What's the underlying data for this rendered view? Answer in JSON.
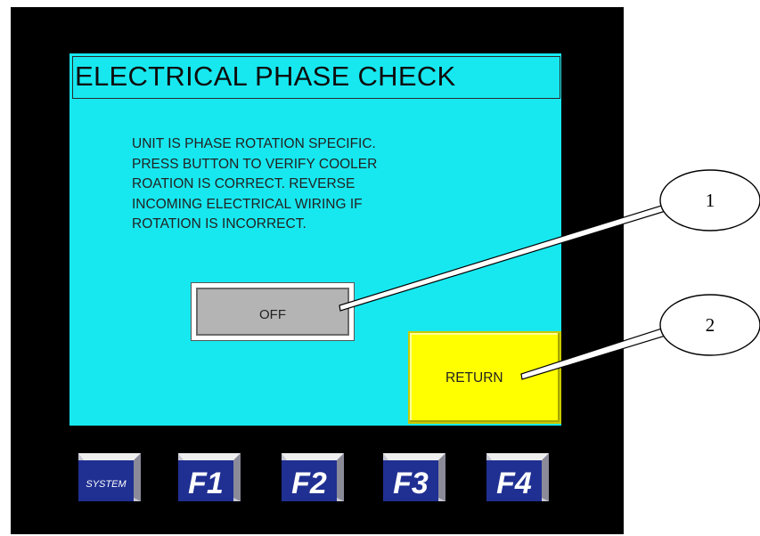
{
  "screen": {
    "title": "ELECTRICAL PHASE CHECK",
    "message_lines": [
      "UNIT IS PHASE ROTATION SPECIFIC.",
      "PRESS BUTTON TO VERIFY COOLER",
      "ROATION IS CORRECT. REVERSE",
      "INCOMING ELECTRICAL WIRING IF",
      "ROTATION IS INCORRECT."
    ],
    "phase_button_label": "OFF",
    "return_button_label": "RETURN"
  },
  "function_keys": [
    {
      "label": "SYSTEM",
      "name": "system-key"
    },
    {
      "label": "F1",
      "name": "f1-key"
    },
    {
      "label": "F2",
      "name": "f2-key"
    },
    {
      "label": "F3",
      "name": "f3-key"
    },
    {
      "label": "F4",
      "name": "f4-key"
    }
  ],
  "callouts": [
    {
      "number": "1"
    },
    {
      "number": "2"
    }
  ],
  "colors": {
    "screen_bg": "#17e8f0",
    "bezel": "#000000",
    "return_button": "#ffff00",
    "off_button": "#b4b4b4",
    "fkey_blue": "#1f2f92"
  }
}
